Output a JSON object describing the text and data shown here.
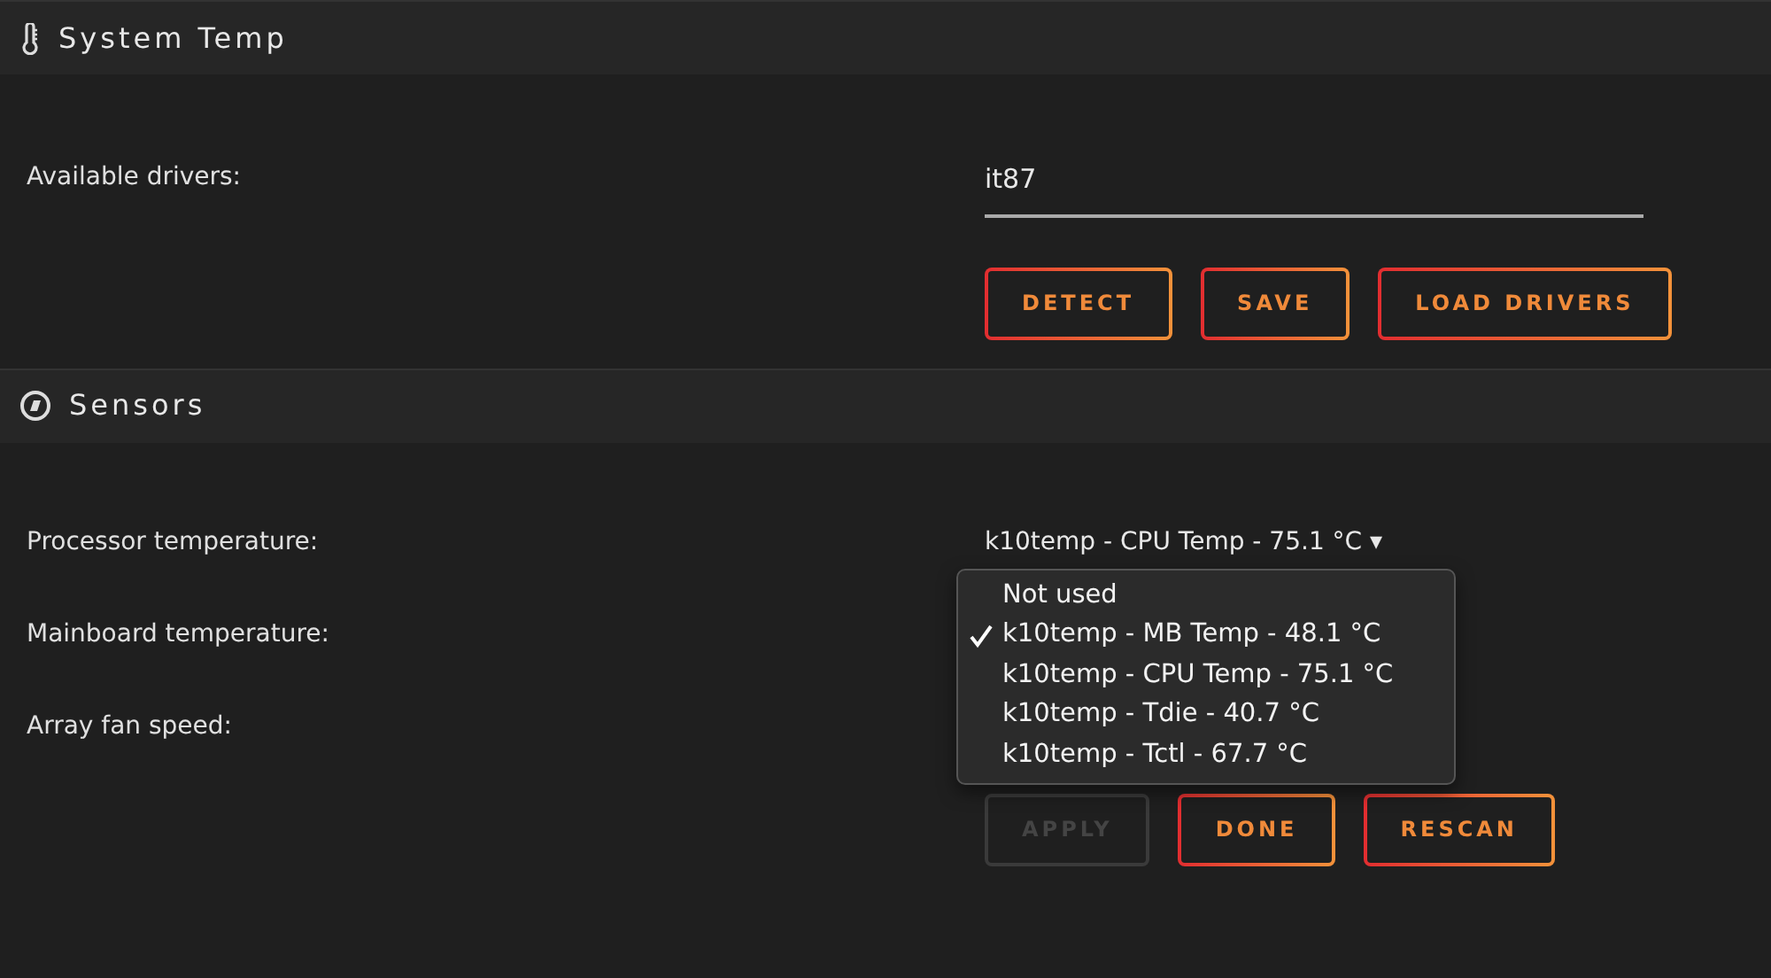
{
  "sections": [
    {
      "title": "System Temp",
      "rows": [
        {
          "label": "Available drivers:",
          "kind": "input",
          "value": "it87"
        }
      ],
      "buttons": [
        {
          "label": "DETECT",
          "disabled": false
        },
        {
          "label": "SAVE",
          "disabled": false
        },
        {
          "label": "LOAD DRIVERS",
          "disabled": false
        }
      ]
    },
    {
      "title": "Sensors",
      "rows": [
        {
          "label": "Processor temperature:",
          "kind": "select",
          "value": "k10temp - CPU Temp - 75.1 °C",
          "caret": "▾"
        },
        {
          "label": "Mainboard temperature:",
          "kind": "covered"
        },
        {
          "label": "Array fan speed:",
          "kind": "covered"
        }
      ],
      "buttons": [
        {
          "label": "APPLY",
          "disabled": true
        },
        {
          "label": "DONE",
          "disabled": false
        },
        {
          "label": "RESCAN",
          "disabled": false
        }
      ],
      "menu": {
        "options": [
          {
            "label": "Not used",
            "selected": false
          },
          {
            "label": "k10temp - MB Temp - 48.1 °C",
            "selected": true
          },
          {
            "label": "k10temp - CPU Temp - 75.1 °C",
            "selected": false
          },
          {
            "label": "k10temp - Tdie - 40.7 °C",
            "selected": false
          },
          {
            "label": "k10temp - Tctl - 67.7 °C",
            "selected": false
          }
        ]
      }
    }
  ]
}
